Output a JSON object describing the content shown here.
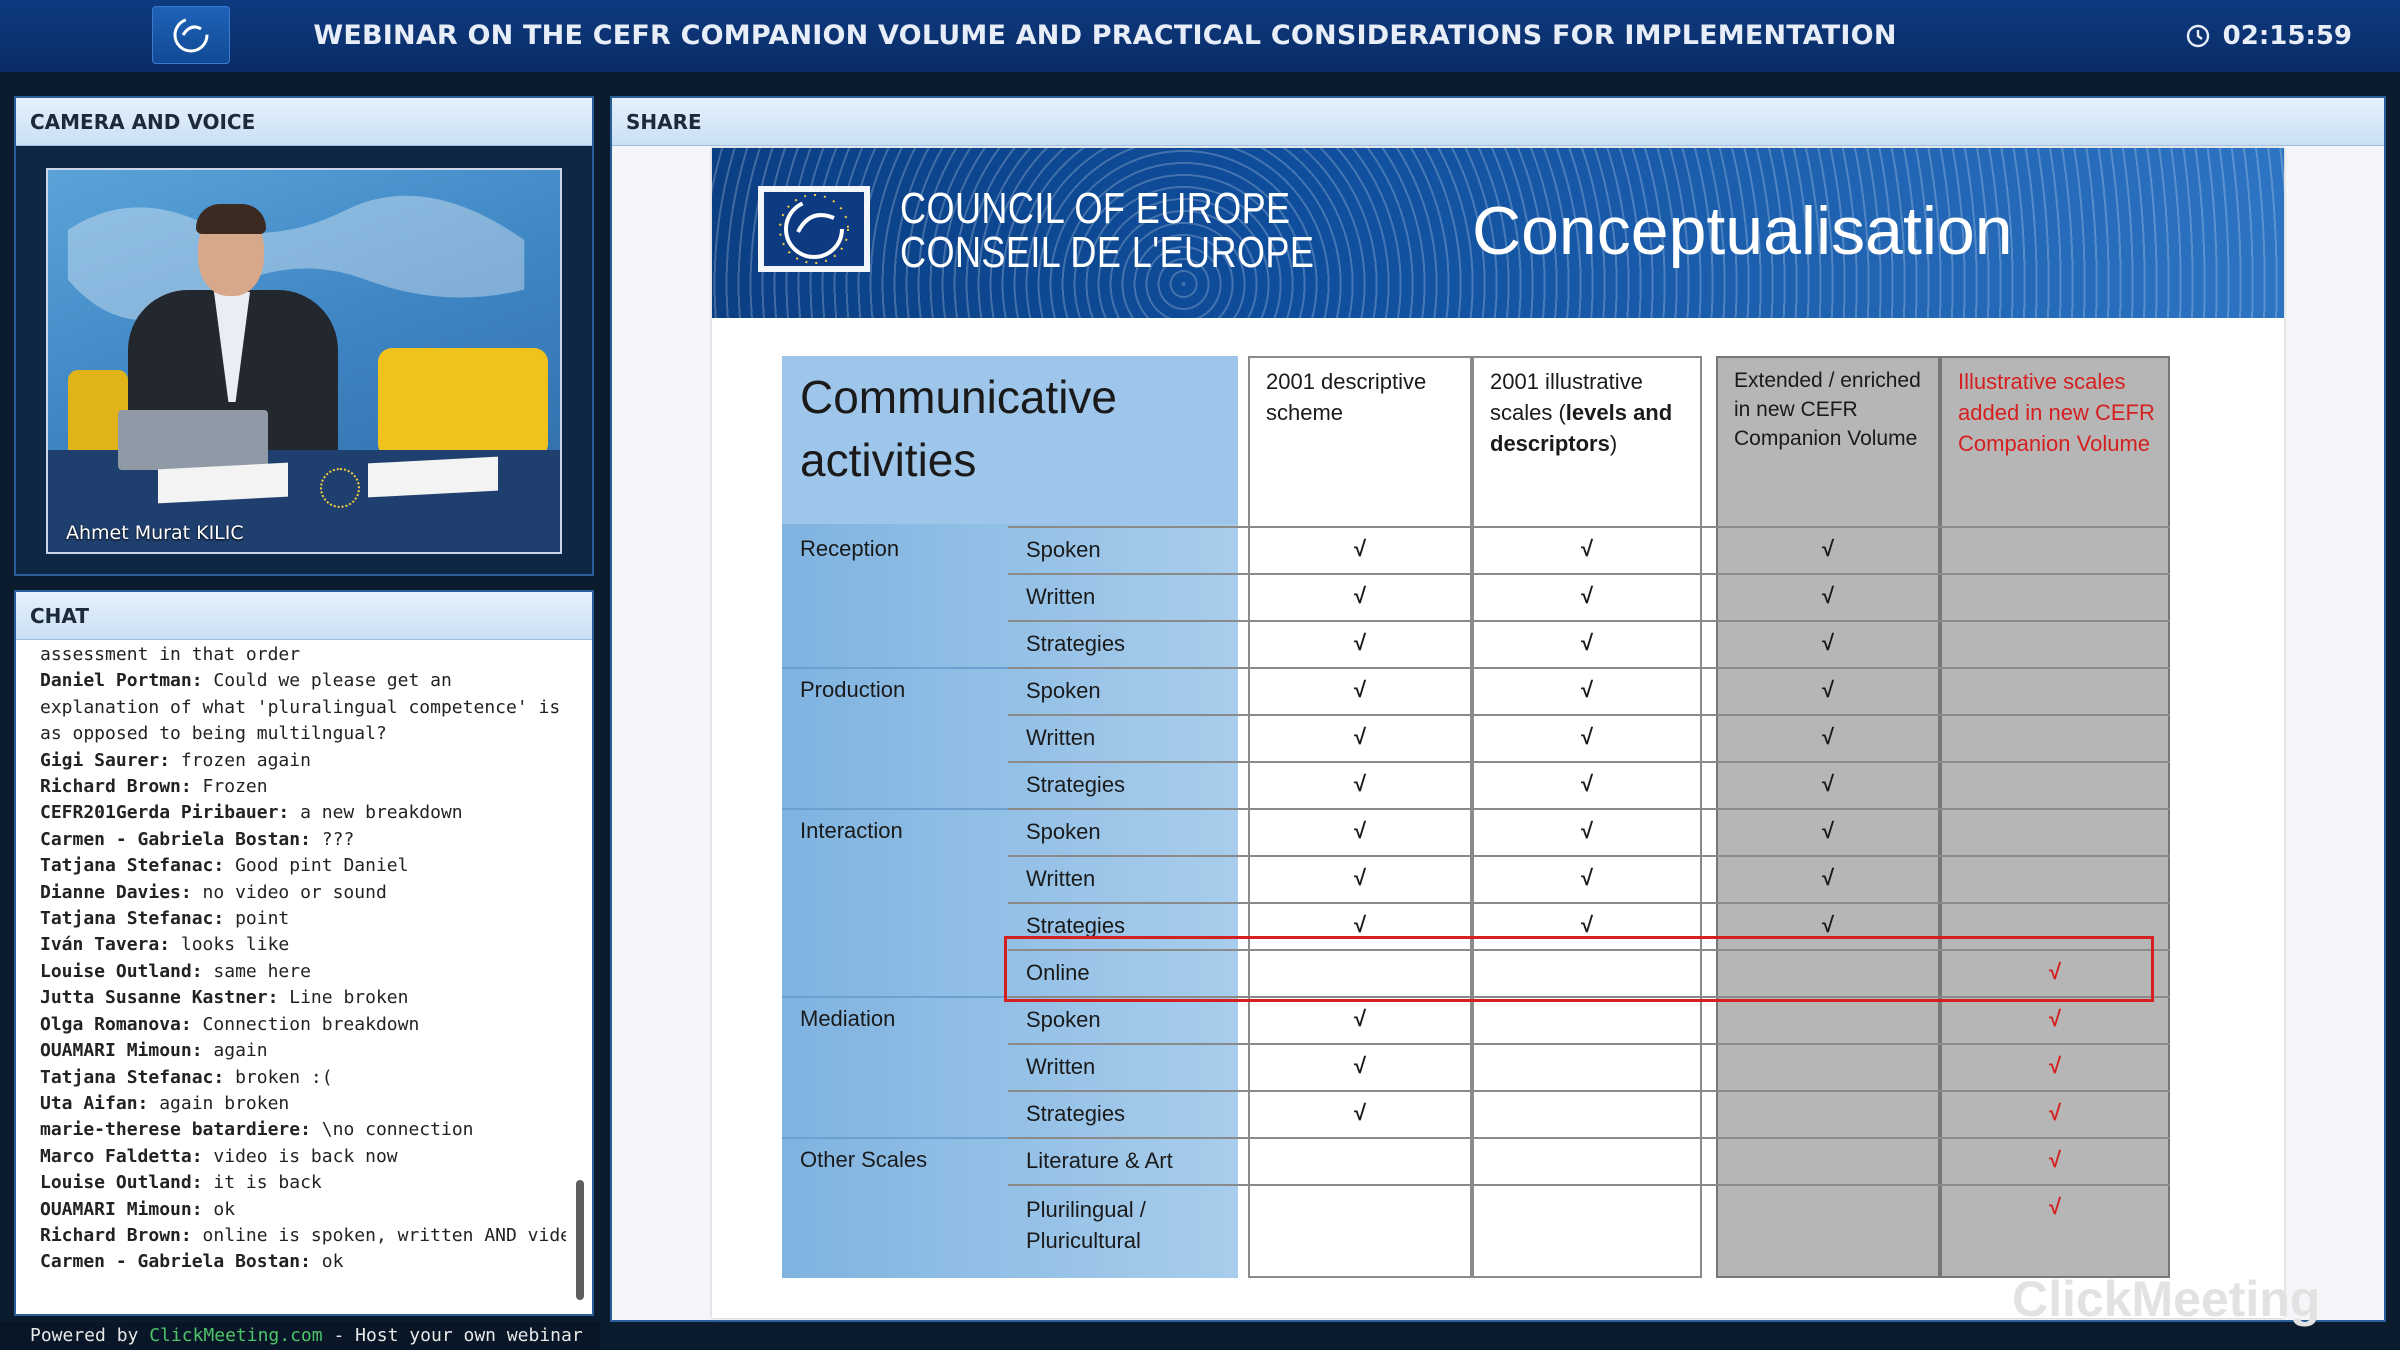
{
  "header": {
    "title": "WEBINAR ON THE CEFR COMPANION VOLUME AND PRACTICAL CONSIDERATIONS FOR IMPLEMENTATION",
    "timer": "02:15:59"
  },
  "camera": {
    "header": "CAMERA AND VOICE",
    "speaker": "Ahmet Murat KILIC"
  },
  "chat": {
    "header": "CHAT",
    "messages": [
      {
        "author": "",
        "text": "assessment in that order"
      },
      {
        "author": "Daniel Portman:",
        "text": " Could we please get an explanation of what 'pluralingual competence' is as opposed to being multilngual?"
      },
      {
        "author": "Gigi Saurer:",
        "text": " frozen again"
      },
      {
        "author": "Richard Brown:",
        "text": " Frozen"
      },
      {
        "author": "CEFR201Gerda Piribauer:",
        "text": " a new breakdown"
      },
      {
        "author": "Carmen - Gabriela Bostan:",
        "text": " ???"
      },
      {
        "author": "Tatjana Stefanac:",
        "text": " Good pint Daniel"
      },
      {
        "author": "Dianne Davies:",
        "text": " no video or sound"
      },
      {
        "author": "Tatjana Stefanac:",
        "text": " point"
      },
      {
        "author": "Iván Tavera:",
        "text": " looks like"
      },
      {
        "author": "Louise Outland:",
        "text": " same here"
      },
      {
        "author": "Jutta Susanne Kastner:",
        "text": " Line broken"
      },
      {
        "author": "Olga Romanova:",
        "text": " Connection breakdown"
      },
      {
        "author": "OUAMARI Mimoun:",
        "text": " again"
      },
      {
        "author": "Tatjana Stefanac:",
        "text": " broken :("
      },
      {
        "author": "Uta Aifan:",
        "text": " again broken"
      },
      {
        "author": "marie-therese batardiere:",
        "text": " \\no connection"
      },
      {
        "author": "Marco Faldetta:",
        "text": " video is back now"
      },
      {
        "author": "Louise Outland:",
        "text": " it is back"
      },
      {
        "author": "OUAMARI Mimoun:",
        "text": " ok"
      },
      {
        "author": "Richard Brown:",
        "text": " online is spoken, written AND video"
      },
      {
        "author": "Carmen - Gabriela Bostan:",
        "text": " ok"
      }
    ]
  },
  "footer": {
    "powered": "Powered by ",
    "link": "ClickMeeting.com",
    "rest": " - Host your own webinar"
  },
  "share": {
    "header": "SHARE",
    "coe_line1": "COUNCIL OF EUROPE",
    "coe_line2": "CONSEIL DE L'EUROPE",
    "slide_title": "Conceptualisation",
    "table": {
      "corner": "Communicative activities",
      "col1": "2001 descriptive scheme",
      "col2_a": "2001 illustrative scales (",
      "col2_b": "levels and descriptors",
      "col2_c": ")",
      "col3": "Extended / enriched in new CEFR Companion Volume",
      "col4": "Illustrative scales added in new CEFR Companion Volume",
      "check": "√",
      "groups": [
        "Reception",
        "Production",
        "Interaction",
        "Mediation",
        "Other Scales"
      ],
      "rows": [
        {
          "label": "Spoken",
          "c1": true,
          "c2": true,
          "c3": true,
          "c4": false
        },
        {
          "label": "Written",
          "c1": true,
          "c2": true,
          "c3": true,
          "c4": false
        },
        {
          "label": "Strategies",
          "c1": true,
          "c2": true,
          "c3": true,
          "c4": false
        },
        {
          "label": "Spoken",
          "c1": true,
          "c2": true,
          "c3": true,
          "c4": false
        },
        {
          "label": "Written",
          "c1": true,
          "c2": true,
          "c3": true,
          "c4": false
        },
        {
          "label": "Strategies",
          "c1": true,
          "c2": true,
          "c3": true,
          "c4": false
        },
        {
          "label": "Spoken",
          "c1": true,
          "c2": true,
          "c3": true,
          "c4": false
        },
        {
          "label": "Written",
          "c1": true,
          "c2": true,
          "c3": true,
          "c4": false
        },
        {
          "label": "Strategies",
          "c1": true,
          "c2": true,
          "c3": true,
          "c4": false
        },
        {
          "label": "Online",
          "c1": false,
          "c2": false,
          "c3": false,
          "c4": true
        },
        {
          "label": "Spoken",
          "c1": true,
          "c2": false,
          "c3": false,
          "c4": true
        },
        {
          "label": "Written",
          "c1": true,
          "c2": false,
          "c3": false,
          "c4": true
        },
        {
          "label": "Strategies",
          "c1": true,
          "c2": false,
          "c3": false,
          "c4": true
        },
        {
          "label": "Literature & Art",
          "c1": false,
          "c2": false,
          "c3": false,
          "c4": true
        },
        {
          "label": "Plurilingual / Pluricultural",
          "c1": false,
          "c2": false,
          "c3": false,
          "c4": true
        }
      ]
    },
    "watermark": "ClickMeeting"
  },
  "colors": {
    "accent": "#0d3a80",
    "check_red": "#d42020",
    "highlight": "#d42020"
  },
  "icons": {
    "logo": "council-of-europe-logo-icon",
    "timer": "clock-icon"
  }
}
